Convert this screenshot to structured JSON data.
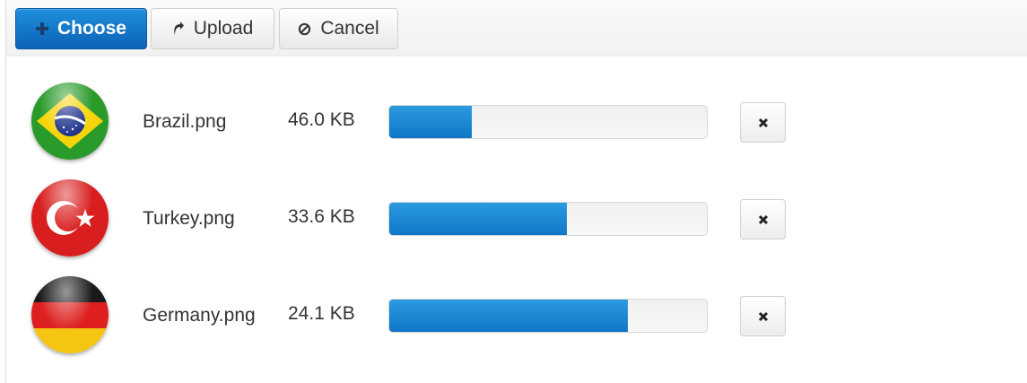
{
  "toolbar": {
    "choose_label": "Choose",
    "choose_icon": "plus-icon",
    "upload_label": "Upload",
    "upload_icon": "upload-arrow-icon",
    "cancel_label": "Cancel",
    "cancel_icon": "ban-icon"
  },
  "files": [
    {
      "name": "Brazil.png",
      "size": "46.0 KB",
      "progress": 0.26,
      "flag": "brazil-flag-icon"
    },
    {
      "name": "Turkey.png",
      "size": "33.6 KB",
      "progress": 0.56,
      "flag": "turkey-flag-icon"
    },
    {
      "name": "Germany.png",
      "size": "24.1 KB",
      "progress": 0.75,
      "flag": "germany-flag-icon"
    }
  ],
  "colors": {
    "accent": "#1b7fd0",
    "progress_bar": "#1a86d2"
  }
}
